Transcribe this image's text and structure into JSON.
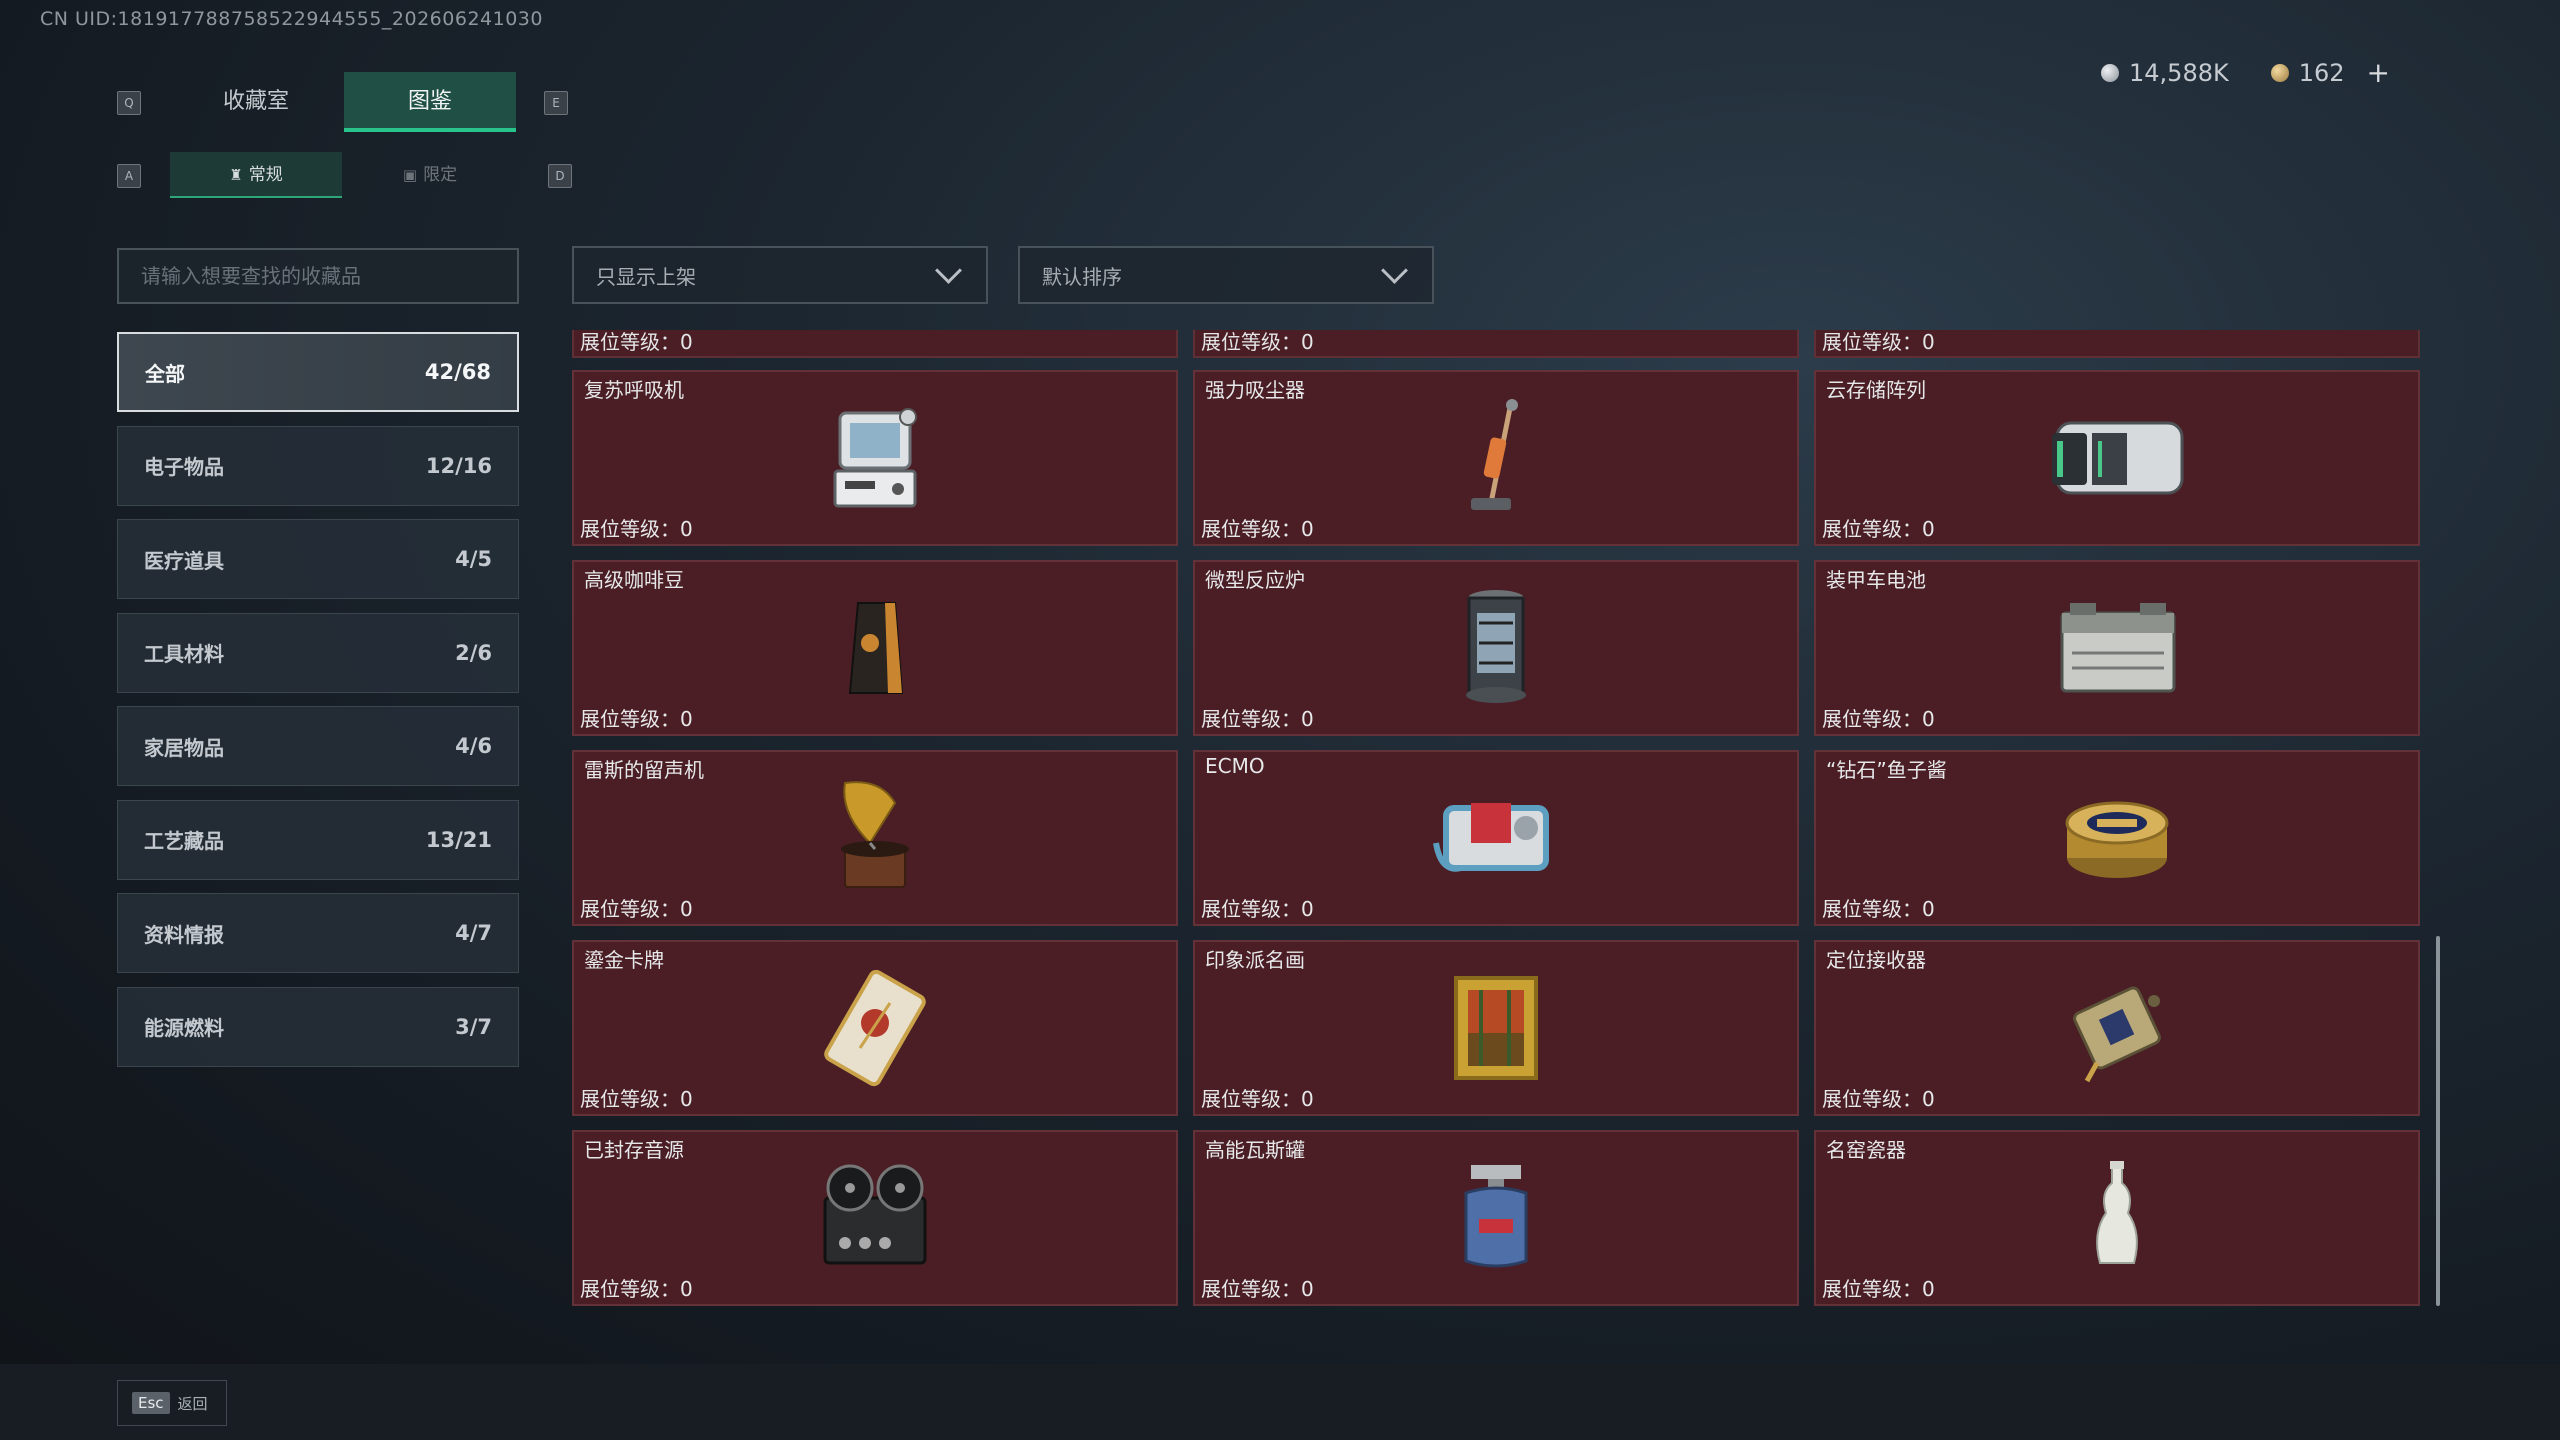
{
  "header": {
    "uid": "CN UID:181917788758522944555_202606241030",
    "currency": [
      {
        "icon": "silver-coin-icon",
        "value": "14,588K"
      },
      {
        "icon": "gold-coin-icon",
        "value": "162"
      }
    ],
    "plus_label": "+"
  },
  "keys": {
    "prev_tab": "Q",
    "next_tab": "E",
    "prev_sub": "A",
    "next_sub": "D",
    "esc": "Esc"
  },
  "tabs": [
    {
      "label": "收藏室",
      "active": false
    },
    {
      "label": "图鉴",
      "active": true
    }
  ],
  "subtabs": [
    {
      "label": "常规",
      "icon": "trophy-icon",
      "active": true
    },
    {
      "label": "限定",
      "icon": "image-icon",
      "active": false
    }
  ],
  "search": {
    "placeholder": "请输入想要查找的收藏品",
    "value": ""
  },
  "categories": [
    {
      "label": "全部",
      "count": "42/68",
      "active": true
    },
    {
      "label": "电子物品",
      "count": "12/16"
    },
    {
      "label": "医疗道具",
      "count": "4/5"
    },
    {
      "label": "工具材料",
      "count": "2/6"
    },
    {
      "label": "家居物品",
      "count": "4/6"
    },
    {
      "label": "工艺藏品",
      "count": "13/21"
    },
    {
      "label": "资料情报",
      "count": "4/7"
    },
    {
      "label": "能源燃料",
      "count": "3/7"
    }
  ],
  "filters": {
    "shelf": "只显示上架",
    "sort": "默认排序"
  },
  "level_label": "展位等级：",
  "partial_row_levels": [
    "0",
    "0",
    "0"
  ],
  "items": [
    {
      "name": "复苏呼吸机",
      "level": "0",
      "icon": "ventilator-icon"
    },
    {
      "name": "强力吸尘器",
      "level": "0",
      "icon": "vacuum-cleaner-icon"
    },
    {
      "name": "云存储阵列",
      "level": "0",
      "icon": "storage-array-icon"
    },
    {
      "name": "高级咖啡豆",
      "level": "0",
      "icon": "coffee-bag-icon"
    },
    {
      "name": "微型反应炉",
      "level": "0",
      "icon": "reactor-icon"
    },
    {
      "name": "装甲车电池",
      "level": "0",
      "icon": "battery-icon"
    },
    {
      "name": "雷斯的留声机",
      "level": "0",
      "icon": "gramophone-icon"
    },
    {
      "name": "ECMO",
      "level": "0",
      "icon": "ecmo-machine-icon"
    },
    {
      "name": "“钻石”鱼子酱",
      "level": "0",
      "icon": "caviar-tin-icon"
    },
    {
      "name": "鎏金卡牌",
      "level": "0",
      "icon": "gilded-card-icon"
    },
    {
      "name": "印象派名画",
      "level": "0",
      "icon": "painting-icon"
    },
    {
      "name": "定位接收器",
      "level": "0",
      "icon": "receiver-icon"
    },
    {
      "name": "已封存音源",
      "level": "0",
      "icon": "tape-recorder-icon"
    },
    {
      "name": "高能瓦斯罐",
      "level": "0",
      "icon": "gas-canister-icon"
    },
    {
      "name": "名窑瓷器",
      "level": "0",
      "icon": "porcelain-vase-icon"
    }
  ],
  "footer": {
    "back_label": "返回"
  }
}
